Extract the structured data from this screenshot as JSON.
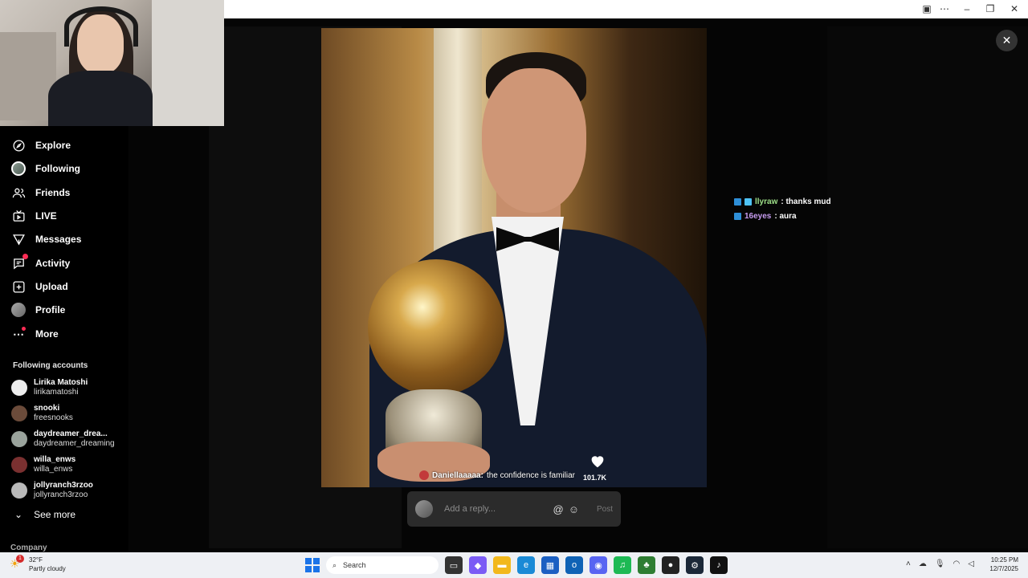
{
  "sidebar": {
    "nav": [
      {
        "label": "Explore",
        "icon": "compass-icon"
      },
      {
        "label": "Following",
        "icon": "following-avatar"
      },
      {
        "label": "Friends",
        "icon": "friends-icon"
      },
      {
        "label": "LIVE",
        "icon": "live-icon"
      },
      {
        "label": "Messages",
        "icon": "messages-icon"
      },
      {
        "label": "Activity",
        "icon": "activity-icon"
      },
      {
        "label": "Upload",
        "icon": "upload-icon"
      },
      {
        "label": "Profile",
        "icon": "profile-avatar"
      },
      {
        "label": "More",
        "icon": "more-icon"
      }
    ],
    "following_title": "Following accounts",
    "accounts": [
      {
        "name": "Lirika Matoshi",
        "handle": "lirikamatoshi",
        "color": "#ededed"
      },
      {
        "name": "snooki",
        "handle": "freesnooks",
        "color": "#6b4b3a"
      },
      {
        "name": "daydreamer_drea...",
        "handle": "daydreamer_dreaming",
        "color": "#9aa39c"
      },
      {
        "name": "willa_enws",
        "handle": "willa_enws",
        "color": "#7a3030"
      },
      {
        "name": "jollyranch3rzoo",
        "handle": "jollyranch3rzoo",
        "color": "#b9b9b9"
      }
    ],
    "see_more": "See more",
    "company": "Company"
  },
  "viewer": {
    "like_count": "101.7K",
    "comment_user": "Daniellaaaaa:",
    "comment_text": "the confidence is familiar",
    "reply_placeholder": "Add a reply...",
    "post_label": "Post",
    "at_symbol": "@"
  },
  "chat": [
    {
      "user": "llyraw",
      "text": ": thanks mud"
    },
    {
      "user": "16eyes",
      "text": ": aura"
    }
  ],
  "taskbar": {
    "weather_temp": "32°F",
    "weather_desc": "Partly cloudy",
    "weather_badge": "1",
    "search_label": "Search",
    "time": "10:25 PM",
    "date": "12/7/2025"
  }
}
